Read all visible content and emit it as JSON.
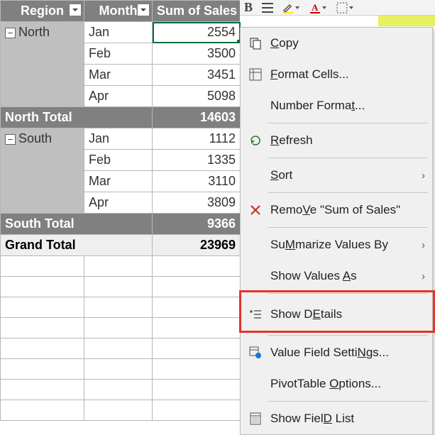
{
  "chart_data": {
    "type": "table",
    "columns": [
      "Region",
      "Month",
      "Sum of Sales"
    ],
    "rows": [
      {
        "region": "North",
        "month": "Jan",
        "value": 2554
      },
      {
        "region": "North",
        "month": "Feb",
        "value": 3500
      },
      {
        "region": "North",
        "month": "Mar",
        "value": 3451
      },
      {
        "region": "North",
        "month": "Apr",
        "value": 5098
      },
      {
        "region": "South",
        "month": "Jan",
        "value": 1112
      },
      {
        "region": "South",
        "month": "Feb",
        "value": 1335
      },
      {
        "region": "South",
        "month": "Mar",
        "value": 3110
      },
      {
        "region": "South",
        "month": "Apr",
        "value": 3809
      }
    ],
    "subtotals": [
      {
        "label": "North Total",
        "value": 14603
      },
      {
        "label": "South Total",
        "value": 9366
      }
    ],
    "grand_total": {
      "label": "Grand Total",
      "value": 23969
    }
  },
  "headers": {
    "region": "Region",
    "month": "Month",
    "sales": "Sum of Sales"
  },
  "regions": {
    "north": {
      "label": "North",
      "total_label": "North Total",
      "total": "14603",
      "rows": [
        {
          "month": "Jan",
          "value": "2554"
        },
        {
          "month": "Feb",
          "value": "3500"
        },
        {
          "month": "Mar",
          "value": "3451"
        },
        {
          "month": "Apr",
          "value": "5098"
        }
      ]
    },
    "south": {
      "label": "South",
      "total_label": "South Total",
      "total": "9366",
      "rows": [
        {
          "month": "Jan",
          "value": "1112"
        },
        {
          "month": "Feb",
          "value": "1335"
        },
        {
          "month": "Mar",
          "value": "3110"
        },
        {
          "month": "Apr",
          "value": "3809"
        }
      ]
    }
  },
  "grand": {
    "label": "Grand Total",
    "value": "23969"
  },
  "toolbar": {
    "bold": "B"
  },
  "ctx": {
    "copy": "Copy",
    "format_cells": "Format Cells...",
    "number_format": "Number Format...",
    "refresh": "Refresh",
    "sort": "Sort",
    "remove": "Remove \"Sum of Sales\"",
    "summarize": "Summarize Values By",
    "show_values_as": "Show Values As",
    "show_details": "Show Details",
    "field_settings": "Value Field Settings...",
    "pivot_options": "PivotTable Options...",
    "show_field_list": "Show Field List",
    "mnemonics": {
      "copy": "C",
      "format_cells": "F",
      "number_format": "t",
      "refresh": "R",
      "sort": "S",
      "remove": "V",
      "summarize": "M",
      "show_values_as": "A",
      "show_details": "E",
      "field_settings": "N",
      "pivot_options": "O",
      "show_field_list": "D"
    }
  }
}
